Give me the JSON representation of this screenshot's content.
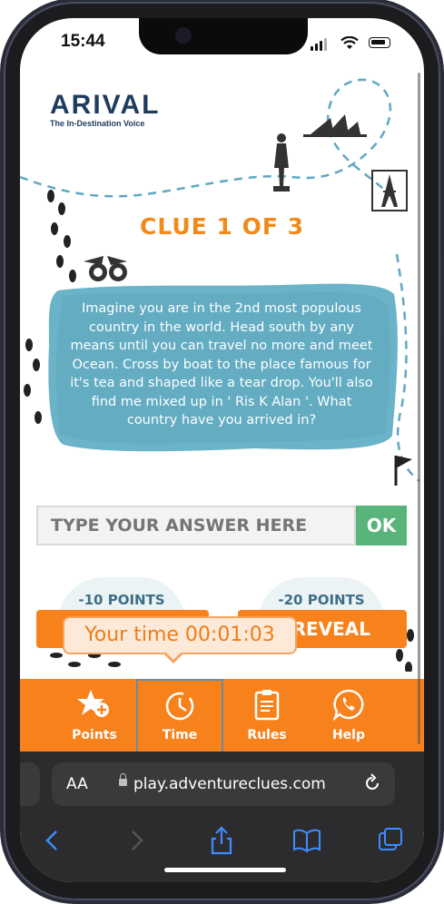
{
  "status": {
    "time": "15:44"
  },
  "brand": {
    "name": "ARIVAL",
    "tagline": "The In-Destination Voice"
  },
  "clue": {
    "title": "CLUE 1 OF 3",
    "text": "Imagine you are in the 2nd most populous country in the world.  Head south by any means until you can travel no more and meet Ocean. Cross by boat to the place famous for it's tea and shaped like a tear drop. You'll also find me mixed up in ' Ris K Alan '. What country have you arrived in?"
  },
  "answer": {
    "placeholder": "TYPE YOUR ANSWER HERE",
    "ok_label": "OK"
  },
  "hints": {
    "left_points": "-10 POINTS",
    "right_points": "-20 POINTS",
    "reveal_label": "REVEAL"
  },
  "timer": {
    "label": "Your time 00:01:03"
  },
  "tabs": [
    {
      "label": "Points",
      "icon": "star-plus-icon"
    },
    {
      "label": "Time",
      "icon": "clock-icon"
    },
    {
      "label": "Rules",
      "icon": "clipboard-icon"
    },
    {
      "label": "Help",
      "icon": "whatsapp-icon"
    }
  ],
  "browser": {
    "aa": "AA",
    "url": "play.adventureclues.com"
  },
  "colors": {
    "accent": "#f7821c",
    "clue_box": "#6bb3c8",
    "ok": "#58b47a",
    "brand": "#1f3c5e"
  }
}
